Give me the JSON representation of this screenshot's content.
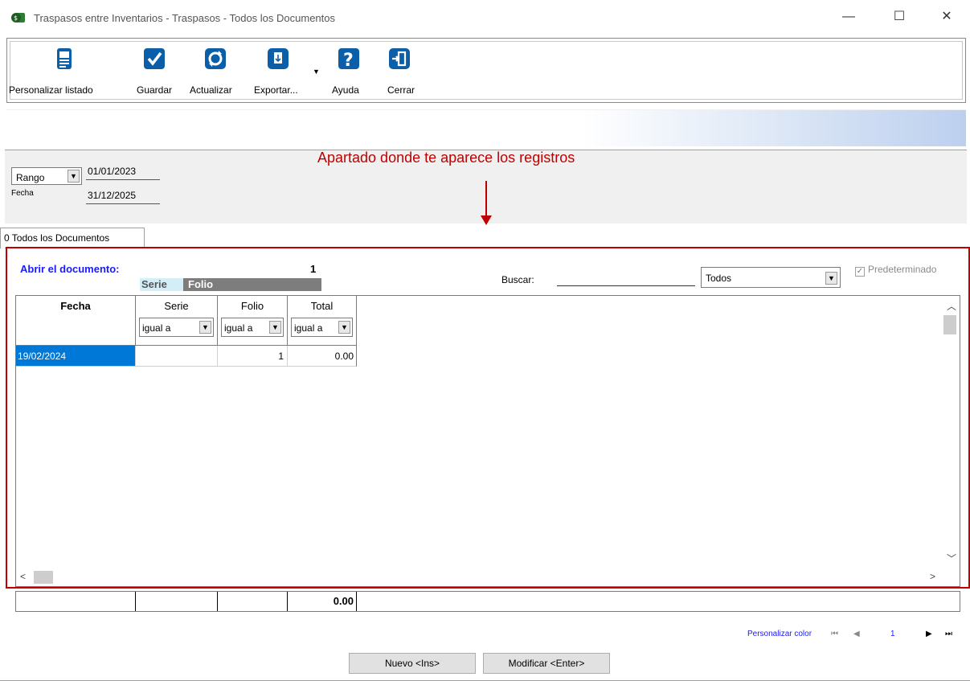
{
  "window": {
    "title": "Traspasos entre Inventarios - Traspasos - Todos los Documentos",
    "minimize": "—",
    "maximize": "☐",
    "close": "✕"
  },
  "toolbar": {
    "personalizar": "Personalizar listado",
    "guardar": "Guardar",
    "actualizar": "Actualizar",
    "exportar": "Exportar...",
    "ayuda": "Ayuda",
    "cerrar": "Cerrar"
  },
  "filter": {
    "range_type": "Rango",
    "fecha_label": "Fecha",
    "date_from": "01/01/2023",
    "date_to": "31/12/2025"
  },
  "annotation": "Apartado donde te aparece los registros",
  "tab": {
    "label": "0 Todos los Documentos"
  },
  "panel": {
    "abrir_label": "Abrir el documento:",
    "abrir_value": "1",
    "serie_tag": "Serie",
    "folio_tag": "Folio",
    "buscar_label": "Buscar:",
    "buscar_value": "",
    "todos_value": "Todos",
    "predeterminado": "Predeterminado"
  },
  "grid": {
    "columns": [
      {
        "label": "Fecha",
        "filter": ""
      },
      {
        "label": "Serie",
        "filter": "igual a"
      },
      {
        "label": "Folio",
        "filter": "igual a"
      },
      {
        "label": "Total",
        "filter": "igual a"
      }
    ],
    "rows": [
      {
        "fecha": "19/02/2024",
        "serie": "",
        "folio": "1",
        "total": "0.00"
      }
    ],
    "totals": {
      "total": "0.00"
    }
  },
  "pager": {
    "personalizar_color": "Personalizar color",
    "page": "1"
  },
  "buttons": {
    "nuevo": "Nuevo <Ins>",
    "modificar": "Modificar <Enter>"
  },
  "colors": {
    "accent_blue": "#1a1aff",
    "annotation_red": "#c00000",
    "selected_row": "#0078d7",
    "icon_blue": "#0b5fa8"
  }
}
